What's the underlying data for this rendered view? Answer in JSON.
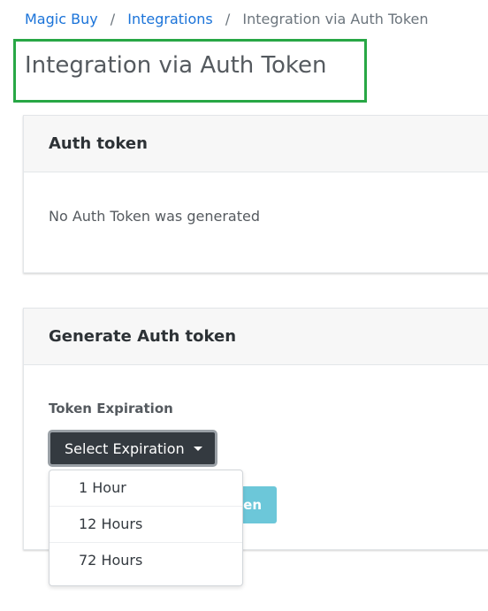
{
  "breadcrumb": {
    "items": [
      {
        "label": "Magic Buy"
      },
      {
        "label": "Integrations"
      },
      {
        "label": "Integration via Auth Token"
      }
    ],
    "separator": "/"
  },
  "page": {
    "title": "Integration via Auth Token",
    "highlight_color": "#28a745"
  },
  "auth_token_card": {
    "header": "Auth token",
    "message": "No Auth Token was generated"
  },
  "generate_card": {
    "header": "Generate Auth token",
    "field_label": "Token Expiration",
    "select_label": "Select Expiration",
    "generate_button_visible_text": "en",
    "options": [
      {
        "label": "1 Hour"
      },
      {
        "label": "12 Hours"
      },
      {
        "label": "72 Hours"
      }
    ]
  },
  "colors": {
    "link": "#1a73d9",
    "select_bg": "#343a40",
    "generate_button_bg": "#6cc7d9"
  },
  "icons": {
    "select_caret": "caret-down-icon"
  }
}
